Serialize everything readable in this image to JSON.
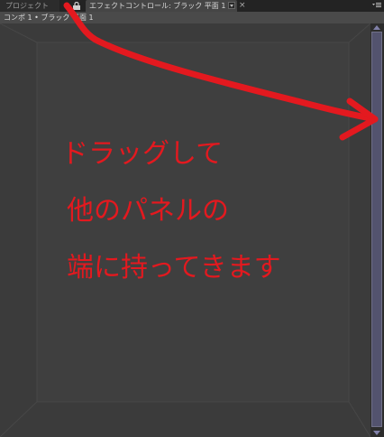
{
  "tabs": {
    "project_label": "プロジェクト",
    "effect_label": "エフェクトコントロール: ブラック 平面 1",
    "close_glyph": "×"
  },
  "breadcrumb": {
    "text": "コンポ 1 • ブラック 平面 1"
  },
  "annotation": {
    "color": "#e3191f",
    "line1": "ドラッグして",
    "line2": "他のパネルの",
    "line3": "端に持ってきます"
  },
  "colors": {
    "panel_bg": "#3b3b3b",
    "scroll_thumb": "#53536e",
    "accent_red": "#e3191f"
  }
}
